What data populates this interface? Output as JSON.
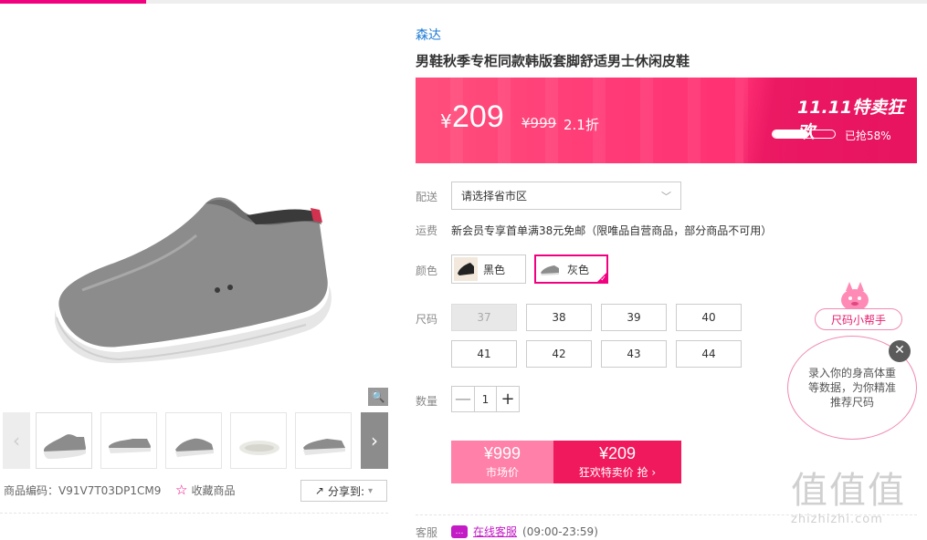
{
  "gallery": {
    "zoom_icon": "magnifier-icon",
    "thumbnails": [
      "thumb-1",
      "thumb-2",
      "thumb-3",
      "thumb-4",
      "thumb-5",
      "thumb-6"
    ],
    "product_code": "商品编码：V91V7T03DP1CM9",
    "favorite_label": "收藏商品",
    "share_label": "分享到:"
  },
  "product": {
    "brand": "森达",
    "title": "男鞋秋季专柜同款韩版套脚舒适男士休闲皮鞋"
  },
  "promo": {
    "currency": "¥",
    "price": "209",
    "original_price": "¥999",
    "discount": "2.1折",
    "event": "11.11特卖狂欢",
    "sold_percent": 58,
    "sold_label": "已抢58%"
  },
  "delivery": {
    "label": "配送",
    "value": "请选择省市区"
  },
  "freight": {
    "label": "运费",
    "text": "新会员专享首单满38元免邮（限唯品自营商品，部分商品不可用）"
  },
  "color": {
    "label": "颜色",
    "options": [
      {
        "name": "黑色",
        "selected": false
      },
      {
        "name": "灰色",
        "selected": true
      }
    ]
  },
  "size": {
    "label": "尺码",
    "options": [
      "37",
      "38",
      "39",
      "40",
      "41",
      "42",
      "43",
      "44"
    ],
    "disabled": [
      "37"
    ]
  },
  "quantity": {
    "label": "数量",
    "minus": "—",
    "value": "1",
    "plus": "+"
  },
  "buy": {
    "market_price": "¥999",
    "market_label": "市场价",
    "sale_price": "¥209",
    "sale_label": "狂欢特卖价 抢"
  },
  "service": {
    "label": "客服",
    "link": "在线客服",
    "hours": "(09:00-23:59)"
  },
  "size_helper": {
    "tag": "尺码小帮手",
    "bubble": "录入你的身高体重等数据，为你精准推荐尺码",
    "close": "✕"
  },
  "watermark": {
    "big": "值值值",
    "small": "zhizhizhi.com"
  },
  "colors": {
    "accent": "#f10180",
    "brand_link": "#1c7ad6",
    "sale_button": "#f1195d",
    "market_button": "#ff80a8"
  }
}
